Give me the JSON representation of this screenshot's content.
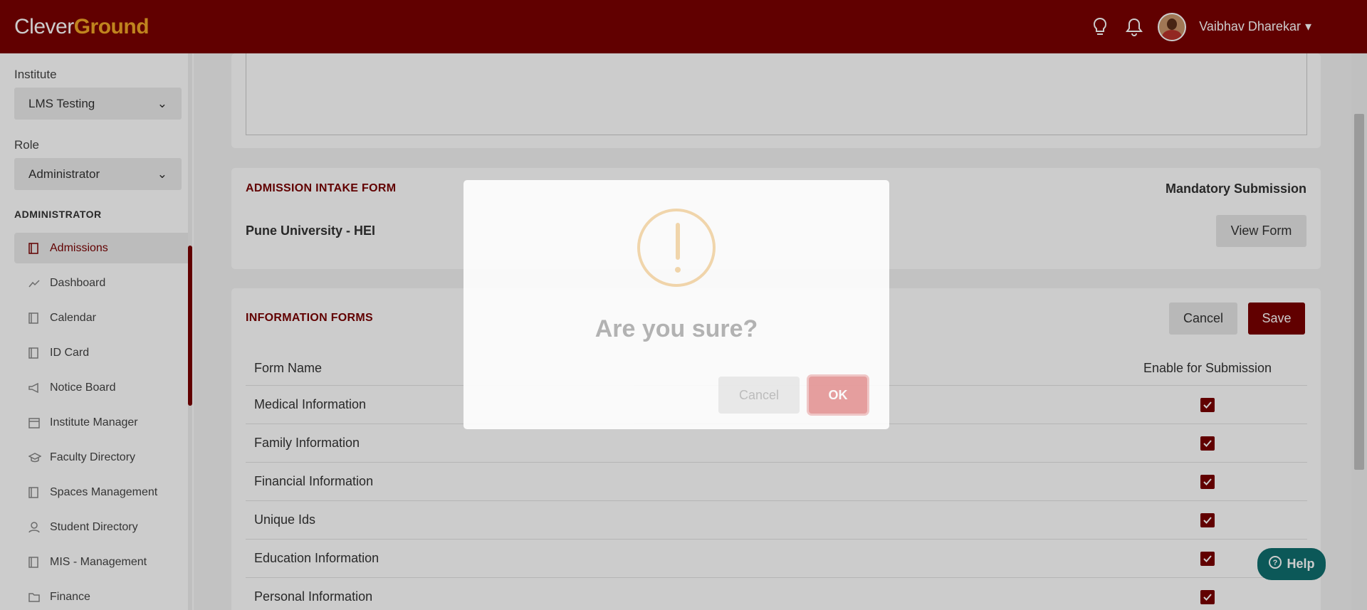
{
  "header": {
    "brand_part1": "Clever",
    "brand_part2": "Ground",
    "username": "Vaibhav Dharekar"
  },
  "sidebar": {
    "institute_label": "Institute",
    "institute_value": "LMS Testing",
    "role_label": "Role",
    "role_value": "Administrator",
    "section_heading": "ADMINISTRATOR",
    "items": [
      {
        "label": "Admissions",
        "icon": "book-icon",
        "active": true
      },
      {
        "label": "Dashboard",
        "icon": "trend-line-icon"
      },
      {
        "label": "Calendar",
        "icon": "book-icon"
      },
      {
        "label": "ID Card",
        "icon": "book-icon"
      },
      {
        "label": "Notice Board",
        "icon": "megaphone-icon"
      },
      {
        "label": "Institute Manager",
        "icon": "calendar-grid-icon"
      },
      {
        "label": "Faculty Directory",
        "icon": "graduation-cap-icon"
      },
      {
        "label": "Spaces Management",
        "icon": "book-icon"
      },
      {
        "label": "Student Directory",
        "icon": "user-icon"
      },
      {
        "label": "MIS - Management",
        "icon": "book-icon"
      },
      {
        "label": "Finance",
        "icon": "folder-icon"
      }
    ]
  },
  "admission_card": {
    "title": "ADMISSION INTAKE FORM",
    "mandatory_label": "Mandatory Submission",
    "university": "Pune University - HEI",
    "view_form_label": "View Form"
  },
  "info_card": {
    "title": "INFORMATION FORMS",
    "cancel_label": "Cancel",
    "save_label": "Save",
    "col_form_name": "Form Name",
    "col_enable": "Enable for Submission",
    "rows": [
      {
        "name": "Medical Information",
        "enabled": true
      },
      {
        "name": "Family Information",
        "enabled": true
      },
      {
        "name": "Financial Information",
        "enabled": true
      },
      {
        "name": "Unique Ids",
        "enabled": true
      },
      {
        "name": "Education Information",
        "enabled": true
      },
      {
        "name": "Personal Information",
        "enabled": true
      }
    ]
  },
  "modal": {
    "title": "Are you sure?",
    "cancel_label": "Cancel",
    "ok_label": "OK"
  },
  "help": {
    "label": "Help"
  },
  "colors": {
    "brand": "#7a0000",
    "accent": "#f0a626",
    "help": "#0f6e6e"
  }
}
